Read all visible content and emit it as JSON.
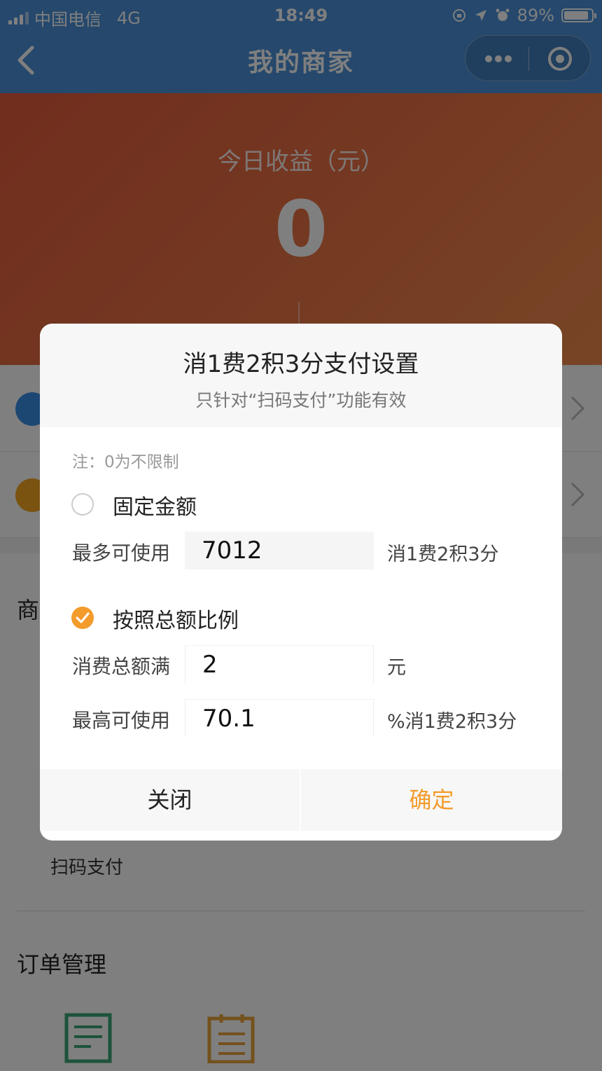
{
  "status_bar": {
    "carrier": "中国电信",
    "network": "4G",
    "time": "18:49",
    "battery": "89%"
  },
  "nav": {
    "title": "我的商家"
  },
  "hero": {
    "label": "今日收益（元）",
    "value": "0"
  },
  "background": {
    "section_partial_title": "商",
    "scan_pay_label": "扫码支付",
    "order_section_title": "订单管理"
  },
  "dialog": {
    "title": "消1费2积3分支付设置",
    "subtitle": "只针对“扫码支付”功能有效",
    "note": "注：0为不限制",
    "option_fixed": {
      "label": "固定金额",
      "selected": false,
      "field_label": "最多可使用",
      "value": "7012",
      "unit": "消1费2积3分"
    },
    "option_ratio": {
      "label": "按照总额比例",
      "selected": true,
      "threshold_label": "消费总额满",
      "threshold_value": "2",
      "threshold_unit": "元",
      "max_label": "最高可使用",
      "max_value": "70.1",
      "max_unit": "%消1费2积3分"
    },
    "close_label": "关闭",
    "confirm_label": "确定"
  },
  "colors": {
    "nav_bg": "#4a90d9",
    "accent": "#f39c2c",
    "hero": "#e25a3c"
  }
}
